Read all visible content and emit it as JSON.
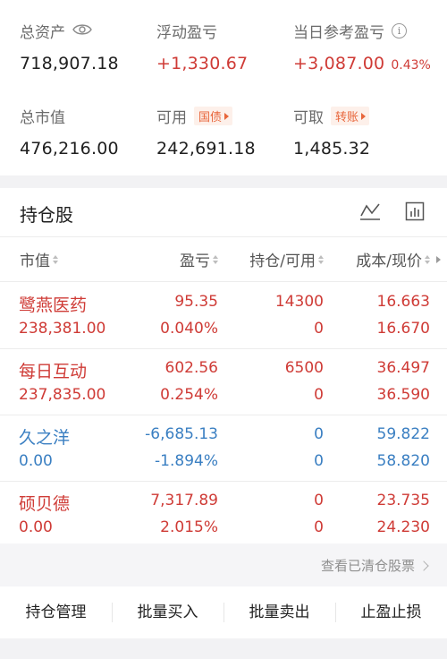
{
  "summary": {
    "total_assets_label": "总资产",
    "total_assets_value": "718,907.18",
    "floating_pl_label": "浮动盈亏",
    "floating_pl_value": "+1,330.67",
    "today_pl_label": "当日参考盈亏",
    "today_pl_value": "+3,087.00",
    "today_pl_pct": "0.43%",
    "market_value_label": "总市值",
    "market_value_value": "476,216.00",
    "available_label": "可用",
    "available_tag": "国债",
    "available_value": "242,691.18",
    "withdrawable_label": "可取",
    "withdrawable_tag": "转账",
    "withdrawable_value": "1,485.32"
  },
  "holdings": {
    "title": "持仓股",
    "columns": {
      "market_value": "市值",
      "pl": "盈亏",
      "hold_avail": "持仓/可用",
      "cost_price": "成本/现价"
    },
    "rows": [
      {
        "name": "鹭燕医药",
        "market_value": "238,381.00",
        "pl": "95.35",
        "pl_pct": "0.040%",
        "hold": "14300",
        "avail": "0",
        "cost": "16.663",
        "price": "16.670",
        "color": "#cf3b36"
      },
      {
        "name": "每日互动",
        "market_value": "237,835.00",
        "pl": "602.56",
        "pl_pct": "0.254%",
        "hold": "6500",
        "avail": "0",
        "cost": "36.497",
        "price": "36.590",
        "color": "#cf3b36"
      },
      {
        "name": "久之洋",
        "market_value": "0.00",
        "pl": "-6,685.13",
        "pl_pct": "-1.894%",
        "hold": "0",
        "avail": "0",
        "cost": "59.822",
        "price": "58.820",
        "color": "#3a7fc2"
      },
      {
        "name": "硕贝德",
        "market_value": "0.00",
        "pl": "7,317.89",
        "pl_pct": "2.015%",
        "hold": "0",
        "avail": "0",
        "cost": "23.735",
        "price": "24.230",
        "color": "#cf3b36"
      }
    ]
  },
  "cleared_link": "查看已清仓股票",
  "actions": [
    "持仓管理",
    "批量买入",
    "批量卖出",
    "止盈止损"
  ],
  "icons": {
    "visibility": "eye-icon",
    "info": "info-icon",
    "trend": "line-chart-icon",
    "bars": "bar-chart-icon",
    "chevron": "chevron-right-icon"
  },
  "colors": {
    "up": "#cf3b36",
    "down": "#3a7fc2",
    "tag": "#e8653a"
  }
}
